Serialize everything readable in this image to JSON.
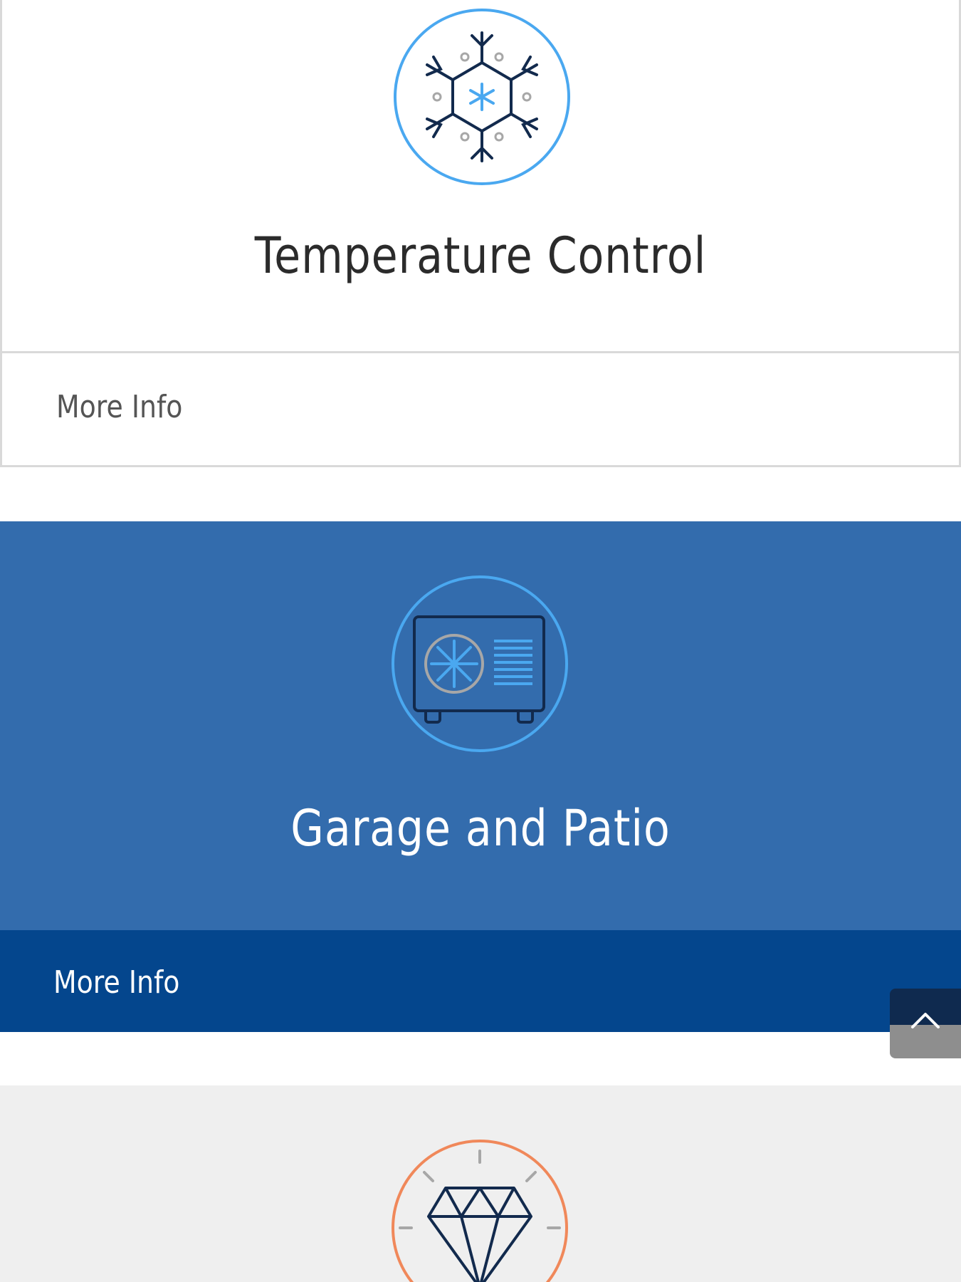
{
  "cards": [
    {
      "title": "Temperature Control",
      "more_label": "More Info",
      "icon": "snowflake-icon",
      "ring_color": "#4aa8f0"
    },
    {
      "title": "Garage and Patio",
      "more_label": "More Info",
      "icon": "air-conditioner-icon",
      "ring_color": "#4aa8f0"
    },
    {
      "title": "",
      "icon": "diamond-icon",
      "ring_color": "#f0885a"
    }
  ],
  "back_to_top": {
    "icon": "chevron-up-icon"
  },
  "colors": {
    "accent_blue": "#336cad",
    "dark_blue": "#04468d",
    "light_blue": "#4aa8f0",
    "navy": "#122a4d",
    "orange": "#f0885a",
    "gray_bg": "#efefef"
  }
}
